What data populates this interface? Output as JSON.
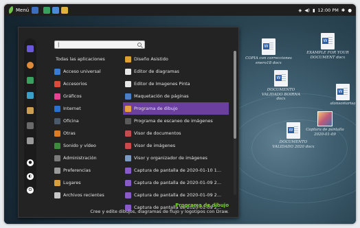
{
  "panel": {
    "menu_label": "Menú",
    "clock": "12:00 PM"
  },
  "desktop_icons": [
    {
      "label": "COPIA con correcciones enero18 docx"
    },
    {
      "label": "EXAMPLE FOR YOUR DOCUMENT docx"
    },
    {
      "label": "DOCUMENTO VALIDADO BOIRNA docx"
    },
    {
      "label": "alonsomarisa"
    },
    {
      "label": "DOCUMENTO VALIDADO 2020 docx"
    },
    {
      "label": "Captura de pantalla 2020-01-09"
    }
  ],
  "search": {
    "value": "|"
  },
  "categories": {
    "all": "Todas las aplicaciones",
    "items": [
      {
        "label": "Acceso universal",
        "color": "#3a7bd5"
      },
      {
        "label": "Accesorios",
        "color": "#d94c3a"
      },
      {
        "label": "Gráficos",
        "color": "#e84393"
      },
      {
        "label": "Internet",
        "color": "#2c6fd1"
      },
      {
        "label": "Oficina",
        "color": "#4a5a6a"
      },
      {
        "label": "Otras",
        "color": "#e07b1f"
      },
      {
        "label": "Sonido y vídeo",
        "color": "#3d8b3d"
      },
      {
        "label": "Administración",
        "color": "#7a7a7a"
      },
      {
        "label": "Preferencias",
        "color": "#9a9a9a"
      },
      {
        "label": "Lugares",
        "color": "#d9a03a"
      },
      {
        "label": "Archivos recientes",
        "color": "#c8c8c8"
      }
    ]
  },
  "apps": [
    {
      "label": "Diseño Asistido",
      "color": "#e0a030"
    },
    {
      "label": "Editor de diagramas",
      "color": "#e8e8e8"
    },
    {
      "label": "Editor de Imagenes Pinta",
      "color": "#e8e8e8"
    },
    {
      "label": "Maquetación de páginas",
      "color": "#4a7fc8"
    },
    {
      "label": "Programa de dibujo",
      "color": "#e8a040",
      "selected": true
    },
    {
      "label": "Programa de escaneo de imágenes",
      "color": "#5a5a5a"
    },
    {
      "label": "Visor de documentos",
      "color": "#c84a4a"
    },
    {
      "label": "Visor de imágenes",
      "color": "#c84a4a"
    },
    {
      "label": "Visor y organizador de imágenes",
      "color": "#7a9ac8"
    },
    {
      "label": "Captura de pantalla de 2020-01-10 1...",
      "color": "#8a5ac8"
    },
    {
      "label": "Captura de pantalla de 2020-01-09 2...",
      "color": "#8a5ac8"
    },
    {
      "label": "Captura de pantalla de 2020-01-09 2...",
      "color": "#8a5ac8"
    },
    {
      "label": "Captura de pantalla de 2020-01-09 2...",
      "color": "#8a5ac8"
    }
  ],
  "footer": {
    "title": "Programa de dibujo",
    "description": "Cree y edite dibujos, diagramas de flujo y logotipos con Draw."
  },
  "colors": {
    "accent": "#6b3fa0",
    "highlight_text": "#7fd13b"
  }
}
